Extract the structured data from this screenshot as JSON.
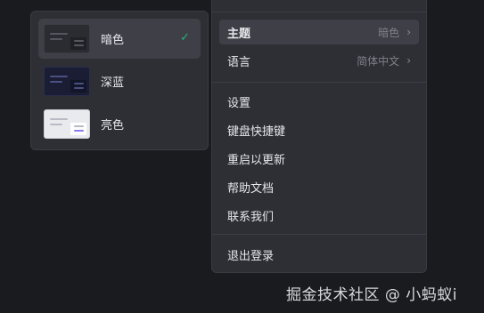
{
  "theme_submenu": {
    "items": [
      {
        "label": "暗色",
        "selected": true,
        "thumb": "dark-theme-thumbnail"
      },
      {
        "label": "深蓝",
        "selected": false,
        "thumb": "deep-blue-theme-thumbnail"
      },
      {
        "label": "亮色",
        "selected": false,
        "thumb": "light-theme-thumbnail"
      }
    ],
    "check_icon": "✓",
    "check_color": "#28b27c"
  },
  "main_menu": {
    "theme": {
      "label": "主题",
      "value": "暗色"
    },
    "language": {
      "label": "语言",
      "value": "简体中文"
    },
    "chevron_icon": "›",
    "settings": "设置",
    "shortcuts": "键盘快捷键",
    "restart_update": "重启以更新",
    "help_docs": "帮助文档",
    "contact_us": "联系我们",
    "logout": "退出登录"
  },
  "watermark": "掘金技术社区 @ 小蚂蚁i"
}
